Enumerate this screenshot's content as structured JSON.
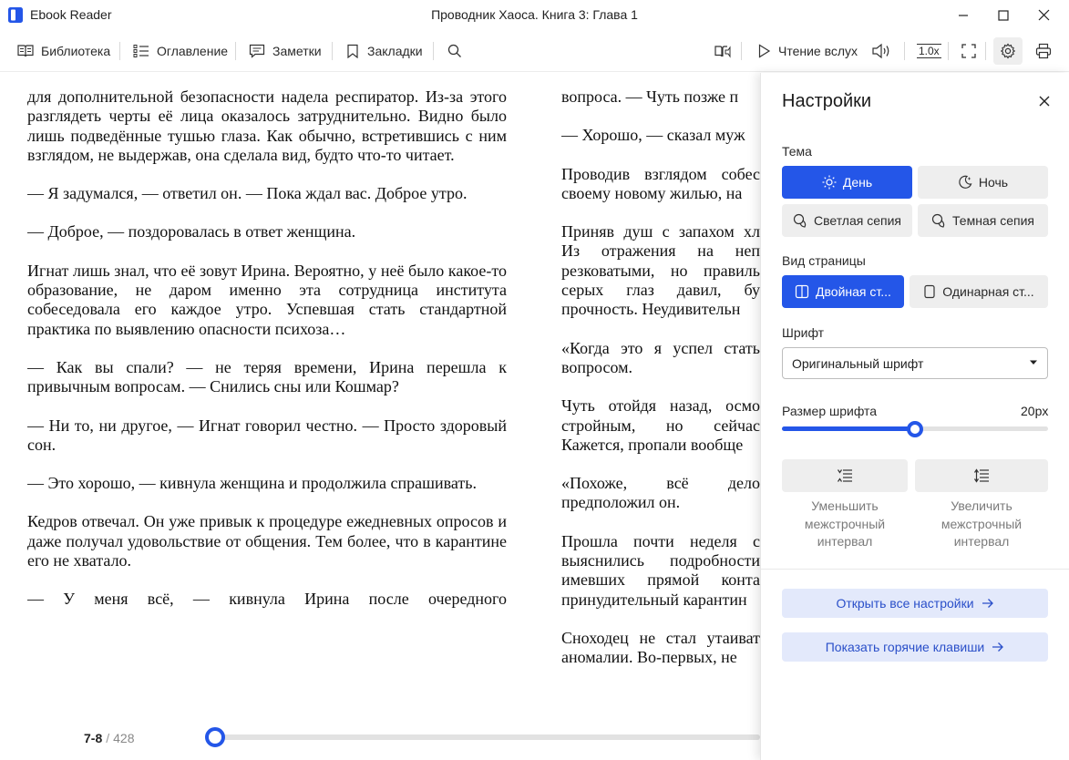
{
  "app": {
    "name": "Ebook Reader",
    "window_title": "Проводник Хаоса. Книга 3: Глава 1"
  },
  "toolbar": {
    "library": "Библиотека",
    "toc": "Оглавление",
    "notes": "Заметки",
    "bookmarks": "Закладки",
    "read_aloud": "Чтение вслух",
    "speed": "1.0x"
  },
  "book": {
    "left_page": [
      "для дополнительной безопасности надела респиратор. Из-за этого разглядеть черты её лица оказалось затруднительно. Видно было лишь подведённые тушью глаза. Как обычно, встретившись с ним взглядом, не выдержав, она сделала вид, будто что-то читает.",
      "— Я задумался, — ответил он. — Пока ждал вас. Доброе утро.",
      "— Доброе, — поздоровалась в ответ женщина.",
      "Игнат лишь знал, что её зовут Ирина. Вероятно, у неё было какое-то образование, не даром именно эта сотрудница института собеседовала его каждое утро. Успевшая стать стандартной практика по выявлению опасности психоза…",
      "— Как вы спали? — не теряя времени, Ирина перешла к привычным вопросам. — Снились сны или Кошмар?",
      "— Ни то, ни другое, — Игнат говорил честно. — Просто здоровый сон.",
      "— Это хорошо, — кивнула женщина и продолжила спрашивать.",
      "Кедров отвечал. Он уже привык к процедуре ежедневных опросов и даже получал удовольствие от общения. Тем более, что в карантине его не хватало.",
      "— У меня всё, — кивнула Ирина после очередного"
    ],
    "right_page": [
      "вопроса. — Чуть позже п",
      "— Хорошо, — сказал муж",
      "Проводив взглядом собес своему новому жилью, на",
      "Приняв душ с запахом хл Из отражения на неп резковатыми, но правиль серых глаз давил, бу прочность. Неудивительн",
      "«Когда это я успел стать вопросом.",
      "Чуть отойдя назад, осмо стройным, но сейчас Кажется, пропали вообще",
      "«Похоже, всё дело предположил он.",
      "Прошла почти неделя с выяснились подробности имевших прямой конта принудительный карантин",
      "Сноходец не стал утаиват аномалии. Во-первых, не"
    ],
    "current_pages": "7-8",
    "total_pages": "428",
    "progress": 0.0
  },
  "settings": {
    "title": "Настройки",
    "theme_label": "Тема",
    "themes": [
      "День",
      "Ночь",
      "Светлая сепия",
      "Темная сепия"
    ],
    "active_theme": "День",
    "page_view_label": "Вид страницы",
    "page_views": [
      "Двойная ст...",
      "Одинарная ст..."
    ],
    "active_page_view": "Двойная ст...",
    "font_label": "Шрифт",
    "font_value": "Оригинальный шрифт",
    "font_size_label": "Размер шрифта",
    "font_size_value": "20px",
    "font_size_fraction": 0.5,
    "decrease_spacing": "Уменьшить межстрочный интервал",
    "increase_spacing": "Увеличить межстрочный интервал",
    "open_all": "Открыть все настройки",
    "hotkeys": "Показать горячие клавиши"
  },
  "colors": {
    "accent": "#2456e8",
    "accent_light": "#e3e9fb",
    "button_bg": "#eeeeee"
  }
}
